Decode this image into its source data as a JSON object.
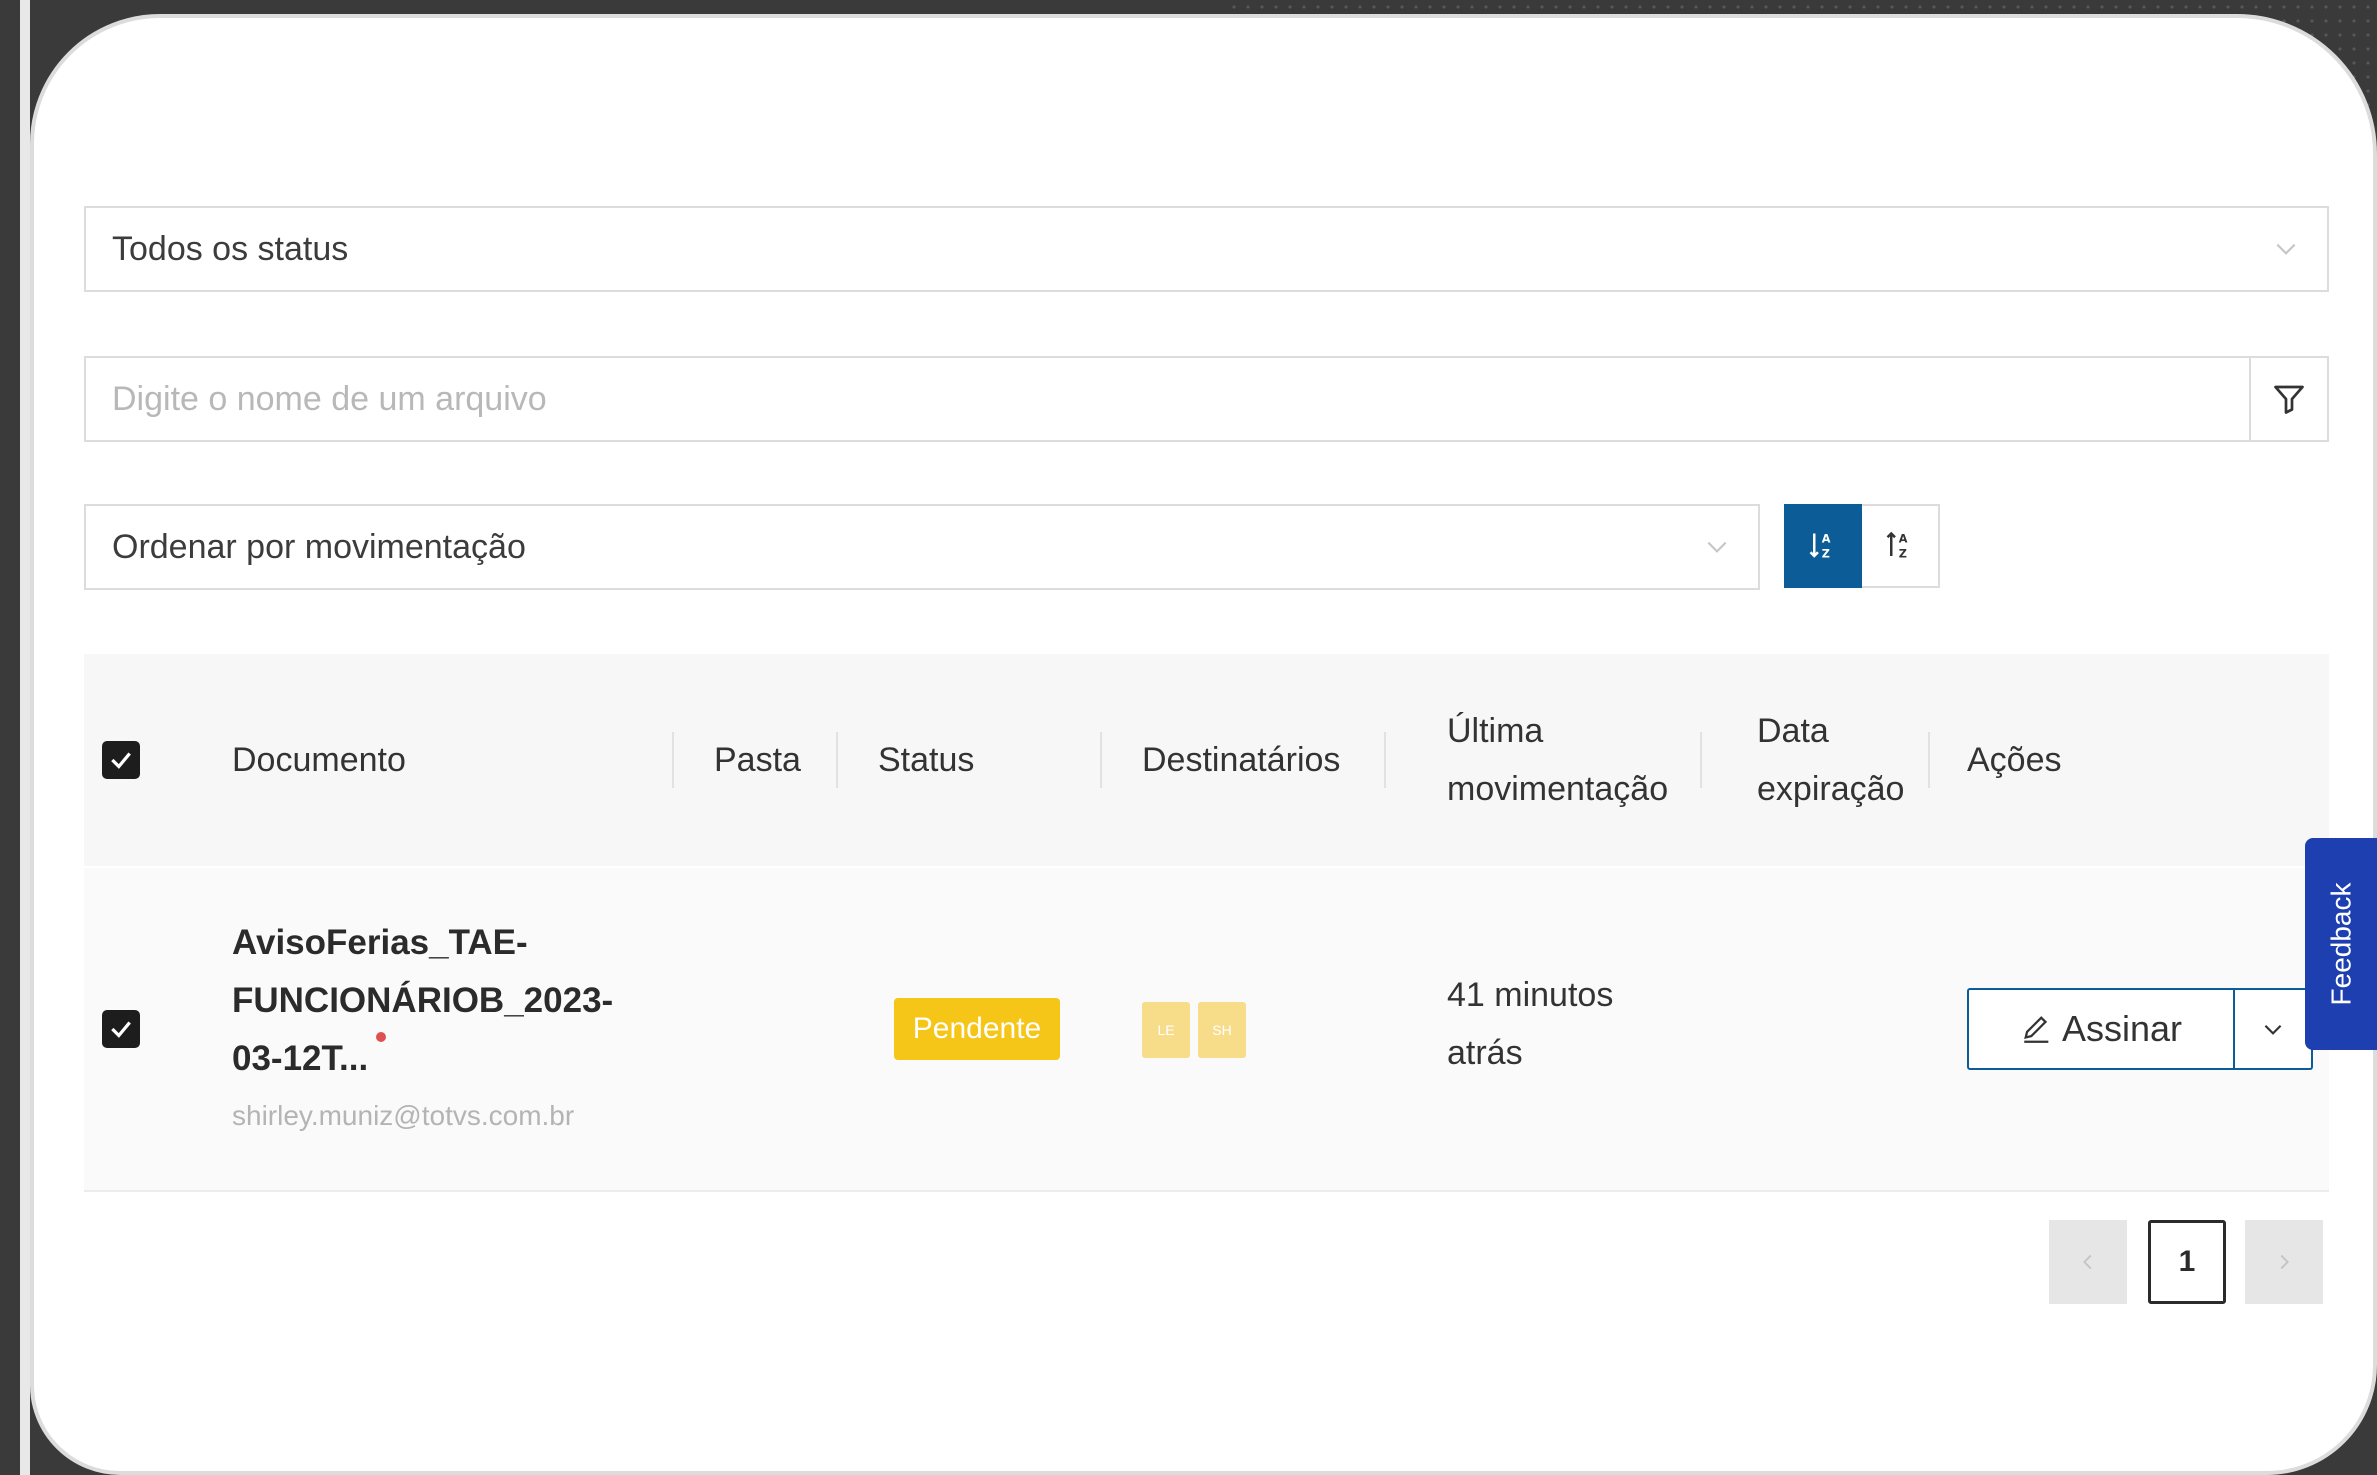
{
  "filters": {
    "status_select": "Todos os status",
    "search_placeholder": "Digite o nome de um arquivo",
    "sort_select": "Ordenar por movimentação"
  },
  "table": {
    "headers": {
      "documento": "Documento",
      "pasta": "Pasta",
      "status": "Status",
      "destinatarios": "Destinatários",
      "ultima_movimentacao_line1": "Última",
      "ultima_movimentacao_line2": "movimentação",
      "data_expiracao_line1": "Data",
      "data_expiracao_line2": "expiração",
      "acoes": "Ações"
    },
    "rows": [
      {
        "doc_line1": "AvisoFerias_TAE-",
        "doc_line2": "FUNCIONÁRIOB_2023-",
        "doc_line3": "03-12T...",
        "email": "shirley.muniz@totvs.com.br",
        "status": "Pendente",
        "recipients": [
          "LE",
          "SH"
        ],
        "last_move_line1": "41 minutos",
        "last_move_line2": "atrás",
        "action_label": "Assinar"
      }
    ]
  },
  "pagination": {
    "current_page": "1"
  },
  "feedback_label": "Feedback",
  "colors": {
    "primary": "#0c5d97",
    "pending": "#f5c518",
    "feedback": "#1d3fb0"
  }
}
